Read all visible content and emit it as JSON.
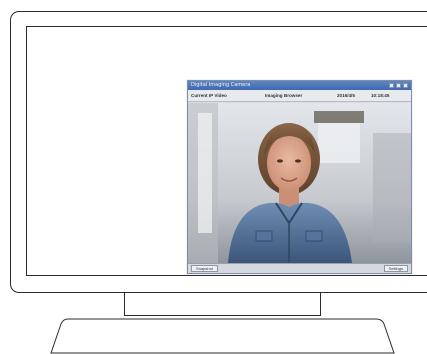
{
  "window": {
    "title": "Digital Imaging Camera",
    "controls": [
      "minimize-icon",
      "maximize-icon",
      "close-icon"
    ]
  },
  "toolbar": {
    "ip_field": "Current IP Video",
    "mode_field": "Imaging Browser",
    "date_field": "2016/4/5",
    "time_field": "10:18:45"
  },
  "statusbar": {
    "left_button": "Snapshot",
    "right_button": "Settings"
  },
  "colors": {
    "titlebar": "#4a73b7",
    "frame": "#2b2b2b",
    "jacket": "#4f6f96"
  }
}
